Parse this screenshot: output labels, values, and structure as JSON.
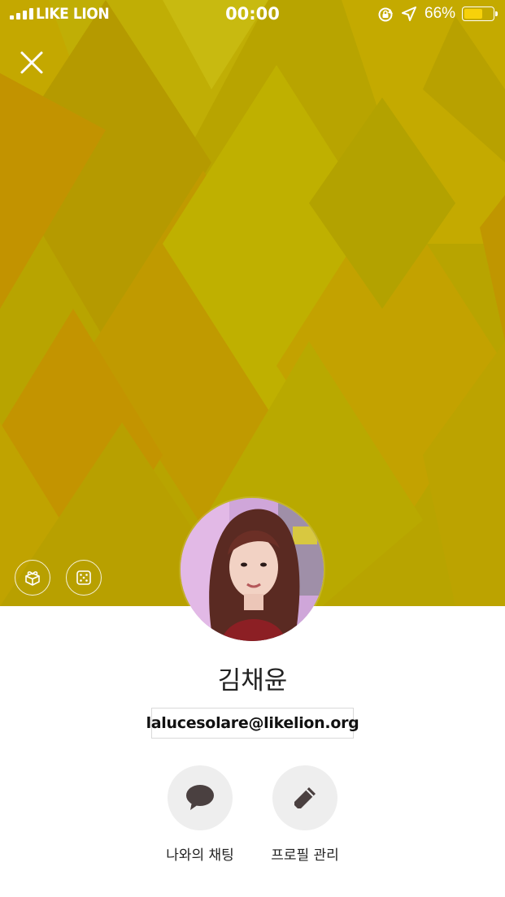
{
  "status_bar": {
    "carrier": "LIKE LION",
    "time": "00:00",
    "battery_percent_text": "66%",
    "battery_level": 0.66
  },
  "header": {
    "close_icon": "close-icon"
  },
  "cover": {
    "background_color": "#b8a400",
    "left_buttons": [
      {
        "icon": "gift-icon"
      },
      {
        "icon": "dice-icon"
      }
    ]
  },
  "profile": {
    "name": "김채윤",
    "status_message": "lalucesolare@likelion.org",
    "avatar_icon": "avatar"
  },
  "actions": [
    {
      "icon": "chat-bubble-icon",
      "label": "나와의 채팅"
    },
    {
      "icon": "pencil-icon",
      "label": "프로필 관리"
    }
  ],
  "colors": {
    "accent_battery": "#f7d10a",
    "action_circle": "#eeeeee",
    "icon_dark": "#4a4040"
  }
}
